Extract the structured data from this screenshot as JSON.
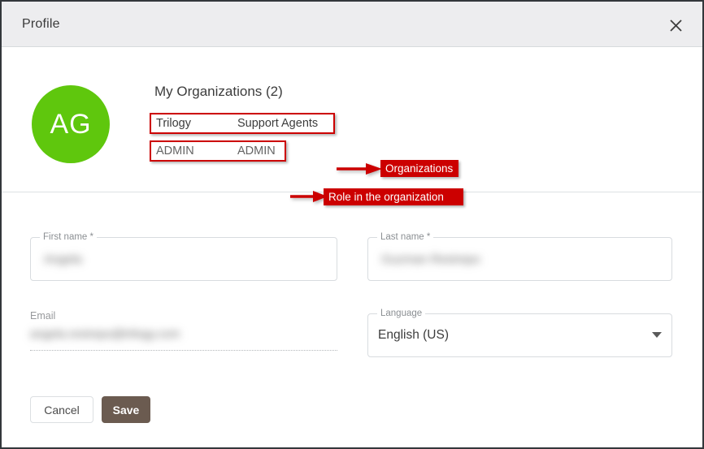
{
  "window": {
    "title": "Profile",
    "close_icon": "close-icon"
  },
  "organizations_section": {
    "avatar": {
      "initials": "AG",
      "color": "#5FC70D"
    },
    "heading": "My Organizations (2)",
    "names_row": {
      "org_1": "Trilogy",
      "org_2": "Support Agents"
    },
    "roles_row": {
      "role_1": "ADMIN",
      "role_2": "ADMIN"
    },
    "annotations": {
      "color": "#CC0000",
      "organizations_badge": "Organizations",
      "role_badge": "Role in the organization",
      "arrow_icon": "right-arrow-icon"
    }
  },
  "form": {
    "first_name": {
      "label": "First name *",
      "value": "Angela",
      "blurred": true
    },
    "last_name": {
      "label": "Last name *",
      "value": "Guzman Restrepo",
      "blurred": true
    },
    "email": {
      "label": "Email",
      "value": "angela.restrepo@trilogy.com",
      "blurred": true,
      "disabled": true
    },
    "language": {
      "label": "Language",
      "value": "English (US)",
      "caret_icon": "chevron-down-icon",
      "options": [
        "English (US)"
      ]
    }
  },
  "footer": {
    "cancel_label": "Cancel",
    "save_label": "Save",
    "save_color": "#6B5B50"
  }
}
